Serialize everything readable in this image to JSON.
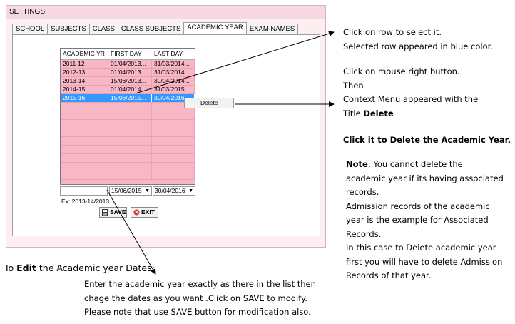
{
  "window": {
    "title": "SETTINGS"
  },
  "tabs": [
    {
      "label": "SCHOOL",
      "active": false
    },
    {
      "label": "SUBJECTS",
      "active": false
    },
    {
      "label": "CLASS",
      "active": false
    },
    {
      "label": "CLASS SUBJECTS",
      "active": false
    },
    {
      "label": "ACADEMIC YEAR",
      "active": true
    },
    {
      "label": "EXAM NAMES",
      "active": false
    }
  ],
  "grid": {
    "headers": [
      "ACADEMIC YR",
      "FIRST DAY",
      "LAST DAY"
    ],
    "rows": [
      [
        "2011-12",
        "01/04/2013...",
        "31/03/2014..."
      ],
      [
        "2012-13",
        "01/04/2013...",
        "31/03/2014..."
      ],
      [
        "2013-14",
        "15/06/2013...",
        "30/04/2014..."
      ],
      [
        "2014-15",
        "01/04/2014...",
        "31/03/2015..."
      ],
      [
        "2015-16",
        "15/06/2015...",
        "30/04/2016"
      ]
    ],
    "selected_row": "2015-16",
    "selected_color": "#3399ff",
    "row_color": "#f8b7c4"
  },
  "context_menu": {
    "item": "Delete"
  },
  "form": {
    "year_value": "",
    "first_day": "15/06/2015",
    "last_day": "30/04/2016",
    "example": "Ex: 2013-14/2013",
    "save_label": "SAVE",
    "exit_label": "EXIT"
  },
  "annotations": {
    "select_1": "Click on row to select it.",
    "select_2": "Selected row appeared in blue color.",
    "ctx_1": "Click on mouse right button.",
    "ctx_2": "Then",
    "ctx_3": "Context Menu appeared with the",
    "ctx_4a": "Title ",
    "ctx_4b": "Delete",
    "click": "Click it to Delete the Academic Year.",
    "note_label": "Note",
    "note_1": ": You cannot delete the",
    "note_2": "academic year if its having associated",
    "note_3": "records.",
    "note_4": "Admission records of the academic",
    "note_5": "year is the example for Associated",
    "note_6": "Records.",
    "note_7": "In this case  to Delete academic year",
    "note_8": "first you will have to delete Admission",
    "note_9": "Records of that year.",
    "edit_a": "To ",
    "edit_b": "Edit",
    "edit_c": " the Academic year Dates:",
    "edit_1": "Enter the academic year exactly as there in the list then",
    "edit_2": "chage the dates as you want .Click on SAVE to modify.",
    "edit_3": "Please note that use SAVE button for modification also."
  }
}
